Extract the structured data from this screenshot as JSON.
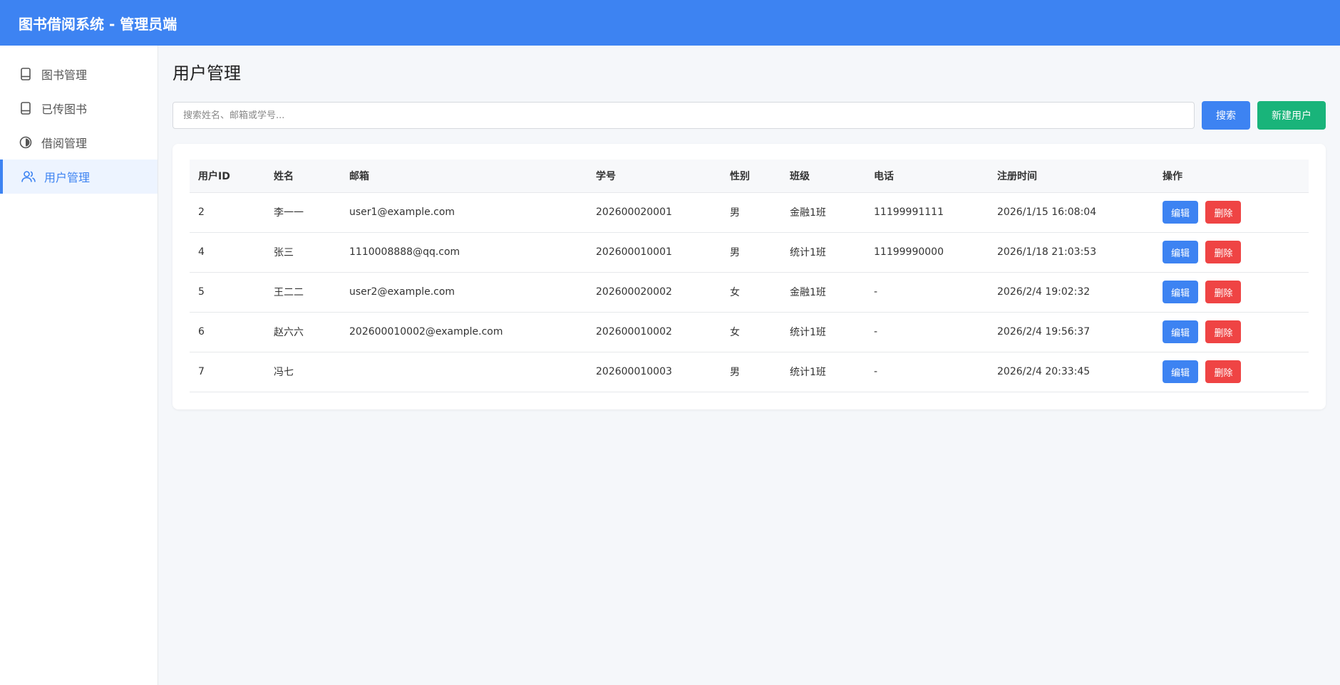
{
  "header": {
    "title": "图书借阅系统 - 管理员端"
  },
  "sidebar": {
    "items": [
      {
        "label": "图书管理",
        "icon": "book-icon"
      },
      {
        "label": "已传图书",
        "icon": "book-icon"
      },
      {
        "label": "借阅管理",
        "icon": "circle-half-icon"
      },
      {
        "label": "用户管理",
        "icon": "users-icon"
      }
    ],
    "active_index": 3
  },
  "main": {
    "title": "用户管理",
    "search": {
      "placeholder": "搜索姓名、邮箱或学号...",
      "value": "",
      "search_label": "搜索",
      "new_label": "新建用户"
    },
    "table": {
      "columns": [
        "用户ID",
        "姓名",
        "邮箱",
        "学号",
        "性别",
        "班级",
        "电话",
        "注册时间",
        "操作"
      ],
      "rows": [
        {
          "id": "2",
          "name": "李一一",
          "email": "user1@example.com",
          "student_id": "202600020001",
          "gender": "男",
          "class": "金融1班",
          "phone": "11199991111",
          "registered": "2026/1/15 16:08:04"
        },
        {
          "id": "4",
          "name": "张三",
          "email": "1110008888@qq.com",
          "student_id": "202600010001",
          "gender": "男",
          "class": "统计1班",
          "phone": "11199990000",
          "registered": "2026/1/18 21:03:53"
        },
        {
          "id": "5",
          "name": "王二二",
          "email": "user2@example.com",
          "student_id": "202600020002",
          "gender": "女",
          "class": "金融1班",
          "phone": "-",
          "registered": "2026/2/4 19:02:32"
        },
        {
          "id": "6",
          "name": "赵六六",
          "email": "202600010002@example.com",
          "student_id": "202600010002",
          "gender": "女",
          "class": "统计1班",
          "phone": "-",
          "registered": "2026/2/4 19:56:37"
        },
        {
          "id": "7",
          "name": "冯七",
          "email": "",
          "student_id": "202600010003",
          "gender": "男",
          "class": "统计1班",
          "phone": "-",
          "registered": "2026/2/4 20:33:45"
        }
      ],
      "edit_label": "编辑",
      "delete_label": "删除"
    }
  },
  "colors": {
    "primary": "#3d83f2",
    "success": "#19b47a",
    "danger": "#ef4444",
    "background": "#f5f7fa"
  }
}
